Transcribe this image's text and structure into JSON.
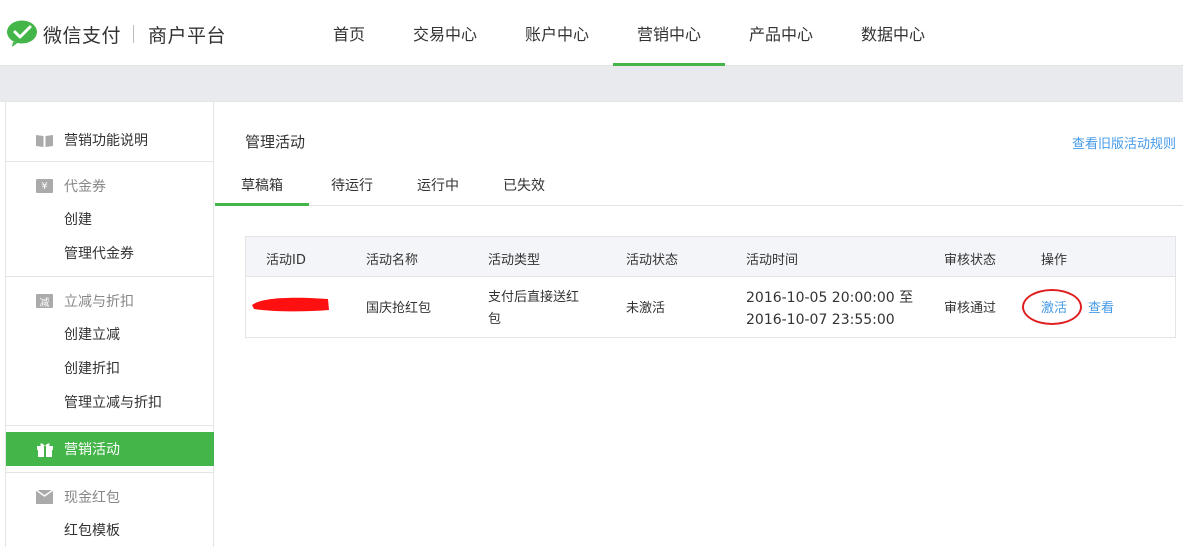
{
  "header": {
    "brand": "微信支付",
    "sub_brand": "商户平台",
    "nav": [
      {
        "label": "首页"
      },
      {
        "label": "交易中心"
      },
      {
        "label": "账户中心"
      },
      {
        "label": "营销中心"
      },
      {
        "label": "产品中心"
      },
      {
        "label": "数据中心"
      }
    ],
    "active_nav": "营销中心"
  },
  "sidebar": {
    "items": [
      {
        "label": "营销功能说明",
        "icon": "book-icon"
      },
      {
        "label": "代金券",
        "icon": "yen-icon"
      },
      {
        "label": "创建"
      },
      {
        "label": "管理代金券"
      },
      {
        "label": "立减与折扣",
        "icon": "discount-icon"
      },
      {
        "label": "创建立减"
      },
      {
        "label": "创建折扣"
      },
      {
        "label": "管理立减与折扣"
      },
      {
        "label": "营销活动",
        "icon": "gift-icon"
      },
      {
        "label": "现金红包",
        "icon": "envelope-icon"
      },
      {
        "label": "红包模板"
      }
    ]
  },
  "main": {
    "title": "管理活动",
    "old_rules_link": "查看旧版活动规则",
    "tabs": [
      {
        "label": "草稿箱"
      },
      {
        "label": "待运行"
      },
      {
        "label": "运行中"
      },
      {
        "label": "已失效"
      }
    ],
    "active_tab": "草稿箱",
    "table": {
      "headers": [
        "活动ID",
        "活动名称",
        "活动类型",
        "活动状态",
        "活动时间",
        "审核状态",
        "操作"
      ],
      "rows": [
        {
          "name": "国庆抢红包",
          "type_line1": "支付后直接送红",
          "type_line2": "包",
          "status": "未激活",
          "time_line1": "2016-10-05 20:00:00 至",
          "time_line2": "2016-10-07 23:55:00",
          "review": "审核通过",
          "action_activate": "激活",
          "action_view": "查看"
        }
      ]
    }
  },
  "colors": {
    "accent_green": "#44b549",
    "link_blue": "#459ae9",
    "annotation_red": "#e02020"
  }
}
